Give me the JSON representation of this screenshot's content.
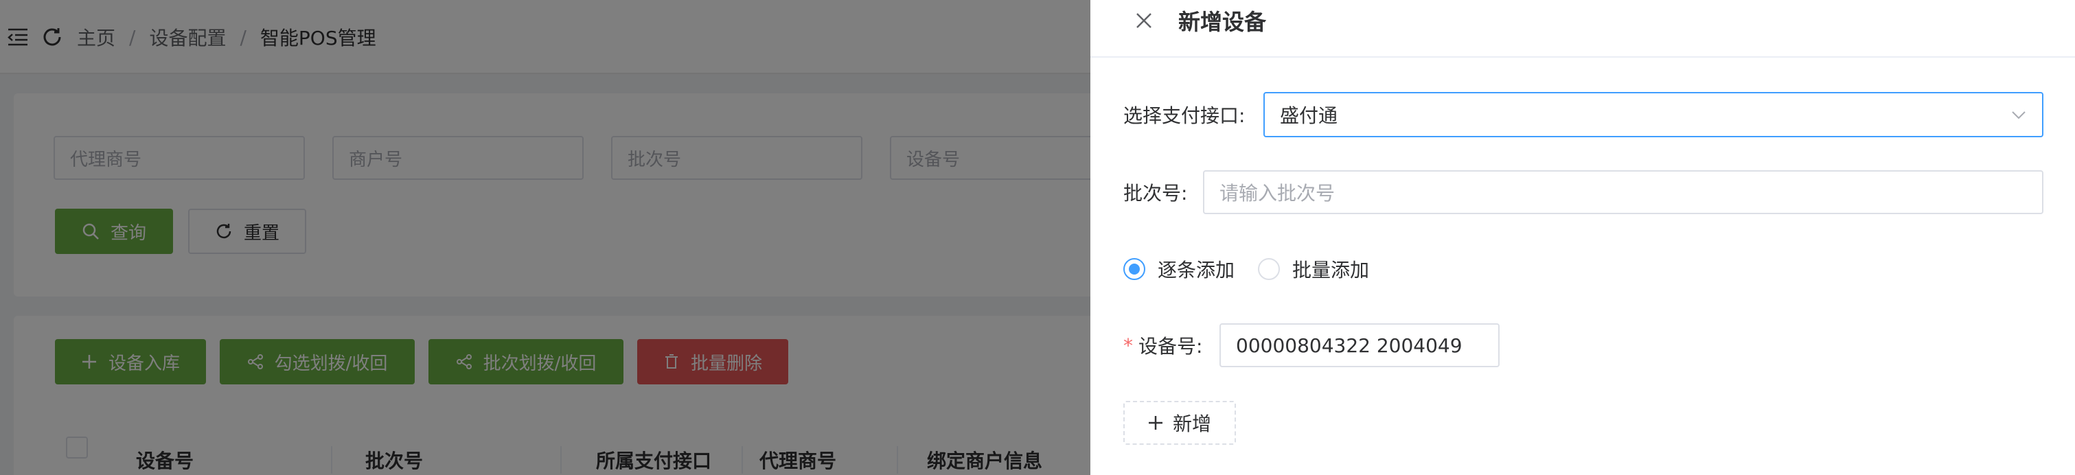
{
  "breadcrumb": {
    "home": "主页",
    "sep": "/",
    "section": "设备配置",
    "current": "智能POS管理"
  },
  "filters": {
    "agent_no": "代理商号",
    "merchant_no": "商户号",
    "batch_no": "批次号",
    "device_no": "设备号"
  },
  "search_buttons": {
    "query": "查询",
    "reset": "重置"
  },
  "actions": {
    "stock_in": "设备入库",
    "select_allocate": "勾选划拨/收回",
    "batch_allocate": "批次划拨/收回",
    "batch_delete": "批量删除"
  },
  "table": {
    "columns": [
      "设备号",
      "批次号",
      "所属支付接口",
      "代理商号",
      "绑定商户信息"
    ]
  },
  "drawer": {
    "title": "新增设备",
    "payment_label": "选择支付接口:",
    "payment_value": "盛付通",
    "batch_label": "批次号:",
    "batch_placeholder": "请输入批次号",
    "mode_options": [
      "逐条添加",
      "批量添加"
    ],
    "selected_mode": "逐条添加",
    "device_label": "设备号:",
    "device_value": "00000804322 2004049",
    "add_label": "新增"
  },
  "colors": {
    "primary": "#409eff",
    "success": "#6aae45",
    "danger": "#e45656",
    "required": "#f56c6c"
  },
  "icons": {
    "menu_fold": "menu-fold-icon",
    "refresh": "refresh-icon",
    "search": "search-icon",
    "reset": "reset-icon",
    "plus": "plus-icon",
    "share": "share-icon",
    "delete": "trash-icon",
    "close": "close-icon",
    "chevron": "chevron-down-icon"
  }
}
